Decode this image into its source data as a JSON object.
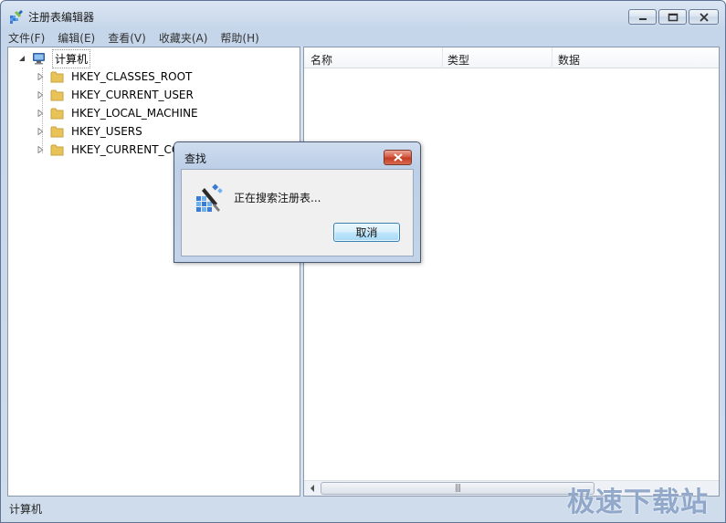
{
  "window": {
    "title": "注册表编辑器"
  },
  "menu": [
    "文件(F)",
    "编辑(E)",
    "查看(V)",
    "收藏夹(A)",
    "帮助(H)"
  ],
  "tree": {
    "root": "计算机",
    "items": [
      "HKEY_CLASSES_ROOT",
      "HKEY_CURRENT_USER",
      "HKEY_LOCAL_MACHINE",
      "HKEY_USERS",
      "HKEY_CURRENT_CONFIG"
    ]
  },
  "list": {
    "columns": [
      "名称",
      "类型",
      "数据"
    ]
  },
  "status": {
    "text": "计算机"
  },
  "dialog": {
    "title": "查找",
    "message": "正在搜索注册表...",
    "cancel_label": "取消"
  },
  "watermark": "极速下载站",
  "icons": {
    "app": "regedit-icon",
    "computer": "computer-icon",
    "folder": "folder-icon",
    "search": "registry-search-icon"
  },
  "colors": {
    "folder": "#e8c35a",
    "dialog_close": "#c9412a",
    "cancel_border": "#3c7fb1"
  }
}
